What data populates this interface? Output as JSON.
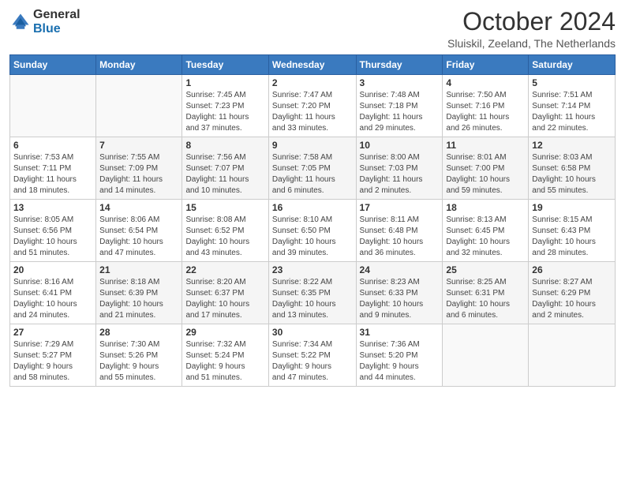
{
  "header": {
    "logo_general": "General",
    "logo_blue": "Blue",
    "title": "October 2024",
    "subtitle": "Sluiskil, Zeeland, The Netherlands"
  },
  "weekdays": [
    "Sunday",
    "Monday",
    "Tuesday",
    "Wednesday",
    "Thursday",
    "Friday",
    "Saturday"
  ],
  "weeks": [
    [
      {
        "day": "",
        "info": ""
      },
      {
        "day": "",
        "info": ""
      },
      {
        "day": "1",
        "info": "Sunrise: 7:45 AM\nSunset: 7:23 PM\nDaylight: 11 hours\nand 37 minutes."
      },
      {
        "day": "2",
        "info": "Sunrise: 7:47 AM\nSunset: 7:20 PM\nDaylight: 11 hours\nand 33 minutes."
      },
      {
        "day": "3",
        "info": "Sunrise: 7:48 AM\nSunset: 7:18 PM\nDaylight: 11 hours\nand 29 minutes."
      },
      {
        "day": "4",
        "info": "Sunrise: 7:50 AM\nSunset: 7:16 PM\nDaylight: 11 hours\nand 26 minutes."
      },
      {
        "day": "5",
        "info": "Sunrise: 7:51 AM\nSunset: 7:14 PM\nDaylight: 11 hours\nand 22 minutes."
      }
    ],
    [
      {
        "day": "6",
        "info": "Sunrise: 7:53 AM\nSunset: 7:11 PM\nDaylight: 11 hours\nand 18 minutes."
      },
      {
        "day": "7",
        "info": "Sunrise: 7:55 AM\nSunset: 7:09 PM\nDaylight: 11 hours\nand 14 minutes."
      },
      {
        "day": "8",
        "info": "Sunrise: 7:56 AM\nSunset: 7:07 PM\nDaylight: 11 hours\nand 10 minutes."
      },
      {
        "day": "9",
        "info": "Sunrise: 7:58 AM\nSunset: 7:05 PM\nDaylight: 11 hours\nand 6 minutes."
      },
      {
        "day": "10",
        "info": "Sunrise: 8:00 AM\nSunset: 7:03 PM\nDaylight: 11 hours\nand 2 minutes."
      },
      {
        "day": "11",
        "info": "Sunrise: 8:01 AM\nSunset: 7:00 PM\nDaylight: 10 hours\nand 59 minutes."
      },
      {
        "day": "12",
        "info": "Sunrise: 8:03 AM\nSunset: 6:58 PM\nDaylight: 10 hours\nand 55 minutes."
      }
    ],
    [
      {
        "day": "13",
        "info": "Sunrise: 8:05 AM\nSunset: 6:56 PM\nDaylight: 10 hours\nand 51 minutes."
      },
      {
        "day": "14",
        "info": "Sunrise: 8:06 AM\nSunset: 6:54 PM\nDaylight: 10 hours\nand 47 minutes."
      },
      {
        "day": "15",
        "info": "Sunrise: 8:08 AM\nSunset: 6:52 PM\nDaylight: 10 hours\nand 43 minutes."
      },
      {
        "day": "16",
        "info": "Sunrise: 8:10 AM\nSunset: 6:50 PM\nDaylight: 10 hours\nand 39 minutes."
      },
      {
        "day": "17",
        "info": "Sunrise: 8:11 AM\nSunset: 6:48 PM\nDaylight: 10 hours\nand 36 minutes."
      },
      {
        "day": "18",
        "info": "Sunrise: 8:13 AM\nSunset: 6:45 PM\nDaylight: 10 hours\nand 32 minutes."
      },
      {
        "day": "19",
        "info": "Sunrise: 8:15 AM\nSunset: 6:43 PM\nDaylight: 10 hours\nand 28 minutes."
      }
    ],
    [
      {
        "day": "20",
        "info": "Sunrise: 8:16 AM\nSunset: 6:41 PM\nDaylight: 10 hours\nand 24 minutes."
      },
      {
        "day": "21",
        "info": "Sunrise: 8:18 AM\nSunset: 6:39 PM\nDaylight: 10 hours\nand 21 minutes."
      },
      {
        "day": "22",
        "info": "Sunrise: 8:20 AM\nSunset: 6:37 PM\nDaylight: 10 hours\nand 17 minutes."
      },
      {
        "day": "23",
        "info": "Sunrise: 8:22 AM\nSunset: 6:35 PM\nDaylight: 10 hours\nand 13 minutes."
      },
      {
        "day": "24",
        "info": "Sunrise: 8:23 AM\nSunset: 6:33 PM\nDaylight: 10 hours\nand 9 minutes."
      },
      {
        "day": "25",
        "info": "Sunrise: 8:25 AM\nSunset: 6:31 PM\nDaylight: 10 hours\nand 6 minutes."
      },
      {
        "day": "26",
        "info": "Sunrise: 8:27 AM\nSunset: 6:29 PM\nDaylight: 10 hours\nand 2 minutes."
      }
    ],
    [
      {
        "day": "27",
        "info": "Sunrise: 7:29 AM\nSunset: 5:27 PM\nDaylight: 9 hours\nand 58 minutes."
      },
      {
        "day": "28",
        "info": "Sunrise: 7:30 AM\nSunset: 5:26 PM\nDaylight: 9 hours\nand 55 minutes."
      },
      {
        "day": "29",
        "info": "Sunrise: 7:32 AM\nSunset: 5:24 PM\nDaylight: 9 hours\nand 51 minutes."
      },
      {
        "day": "30",
        "info": "Sunrise: 7:34 AM\nSunset: 5:22 PM\nDaylight: 9 hours\nand 47 minutes."
      },
      {
        "day": "31",
        "info": "Sunrise: 7:36 AM\nSunset: 5:20 PM\nDaylight: 9 hours\nand 44 minutes."
      },
      {
        "day": "",
        "info": ""
      },
      {
        "day": "",
        "info": ""
      }
    ]
  ]
}
